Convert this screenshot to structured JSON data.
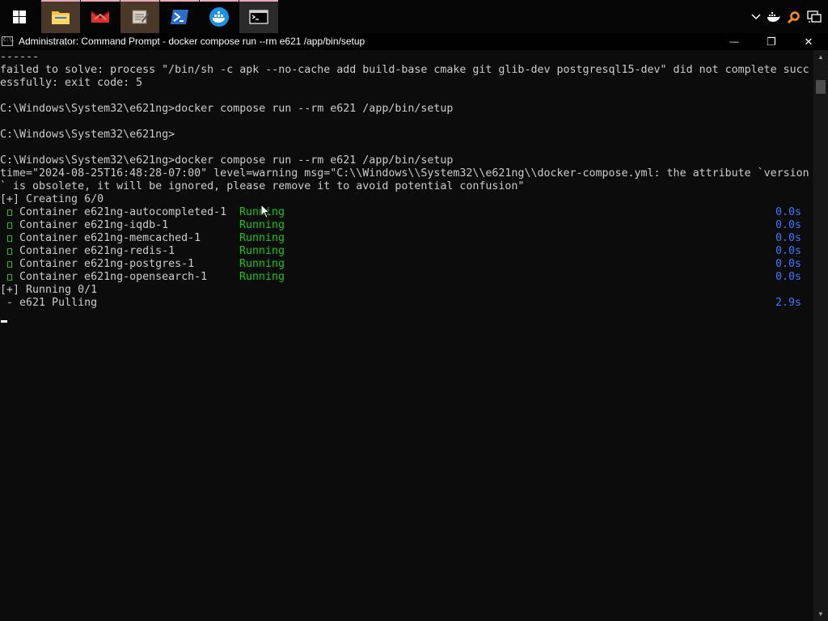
{
  "taskbar": {
    "apps": [
      {
        "name": "start-menu",
        "icon": "windows-logo-icon"
      },
      {
        "name": "file-explorer",
        "icon": "folder-icon"
      },
      {
        "name": "app-red",
        "icon": "red-app-icon"
      },
      {
        "name": "app-notes",
        "icon": "notes-app-icon"
      },
      {
        "name": "powershell",
        "icon": "powershell-icon"
      },
      {
        "name": "docker-desktop",
        "icon": "docker-icon"
      },
      {
        "name": "command-prompt",
        "icon": "terminal-icon"
      }
    ],
    "tray": [
      "chevron-up-icon",
      "docker-tray-icon",
      "search-tray-icon",
      "network-icon"
    ]
  },
  "window": {
    "title": "Administrator: Command Prompt - docker  compose run --rm e621 /app/bin/setup",
    "icon_text": "C:\\.",
    "controls": {
      "minimize": "—",
      "maximize": "❐",
      "close": "✕"
    }
  },
  "console": {
    "lines": [
      "------",
      "failed to solve: process \"/bin/sh -c apk --no-cache add build-base cmake git glib-dev postgresql15-dev\" did not complete succ",
      "essfully: exit code: 5",
      "",
      "C:\\Windows\\System32\\e621ng>docker compose run --rm e621 /app/bin/setup",
      "",
      "C:\\Windows\\System32\\e621ng>",
      "",
      "C:\\Windows\\System32\\e621ng>docker compose run --rm e621 /app/bin/setup",
      "time=\"2024-08-25T16:48:28-07:00\" level=warning msg=\"C:\\\\Windows\\\\System32\\\\e621ng\\\\docker-compose.yml: the attribute `version",
      "` is obsolete, it will be ignored, please remove it to avoid potential confusion\"",
      "[+] Creating 6/0"
    ],
    "containers": [
      {
        "label": " Container e621ng-autocompleted-1",
        "status": "Running",
        "time": "0.0s"
      },
      {
        "label": " Container e621ng-iqdb-1",
        "status": "Running",
        "time": "0.0s"
      },
      {
        "label": " Container e621ng-memcached-1",
        "status": "Running",
        "time": "0.0s"
      },
      {
        "label": " Container e621ng-redis-1",
        "status": "Running",
        "time": "0.0s"
      },
      {
        "label": " Container e621ng-postgres-1",
        "status": "Running",
        "time": "0.0s"
      },
      {
        "label": " Container e621ng-opensearch-1",
        "status": "Running",
        "time": "0.0s"
      }
    ],
    "running_header": "[+] Running 0/1",
    "pull_line": {
      "label": " - e621 Pulling",
      "time": "2.9s"
    },
    "colors": {
      "text": "#cccccc",
      "green": "#16c60c",
      "blue": "#3b78ff",
      "background": "#0c0c0c"
    }
  }
}
